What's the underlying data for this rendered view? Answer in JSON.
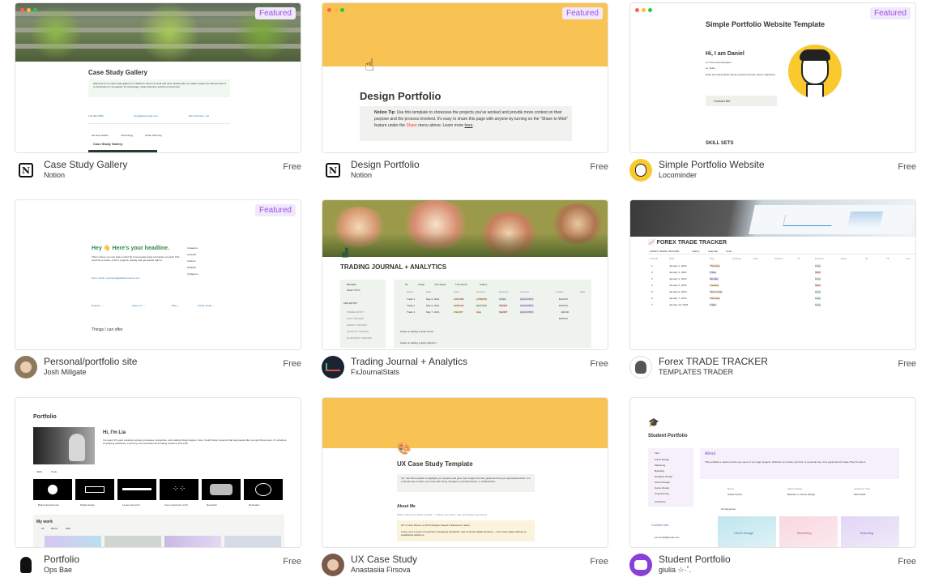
{
  "featured_label": "Featured",
  "templates": [
    {
      "name": "Case Study Gallery",
      "creator": "Notion",
      "price": "Free",
      "featured": true,
      "avatar_icon": "notion-logo-icon",
      "preview": {
        "title": "Case Study Gallery",
        "callout": "Welcome to my case study gallery! I'm thrilled to share my work and case studies with you. Each project you will see here is a culmination of my passion for technology, urban planning, and the environment.",
        "contacts": [
          "123-456-7890",
          "hey@placeomain.com",
          "San Francisco, CA"
        ],
        "tabs": [
          "All case studies",
          "Technology",
          "Urban Planning"
        ],
        "section": "Case Study Gallery"
      }
    },
    {
      "name": "Design Portfolio",
      "creator": "Notion",
      "price": "Free",
      "featured": true,
      "avatar_icon": "notion-logo-icon",
      "preview": {
        "title": "Design Portfolio",
        "tip_label": "Notion Tip:",
        "tip": "Use this template to showcase the projects you've worked and provide more context on their purpose and the process involved. It's easy to share this page with anyone by turning on the \"Share to Web\" feature under the",
        "share": "Share",
        "tip_end": "menu above. Learn more",
        "link": "here"
      }
    },
    {
      "name": "Simple Portfolio Website",
      "creator": "Locominder",
      "price": "Free",
      "featured": true,
      "avatar_icon": "cartoon-avatar-icon",
      "preview": {
        "title": "Simple Portfolio Website Template",
        "greeting": "Hi, I am Daniel",
        "role": "I'm Front-end developer",
        "years": "3+ Years",
        "desc": "Enter short description about yourself and your career objectives",
        "button": "Contact Me",
        "skills": "SKILL SETS"
      }
    },
    {
      "name": "Personal/portfolio site",
      "creator": "Josh Millgate",
      "price": "Free",
      "featured": true,
      "avatar_icon": "person-avatar-icon",
      "preview": {
        "headline": "Hey 👋 Here's your headline.",
        "body": "This is where you can write a short bit to let people know a bit about yourself. This could be a career, a list of projects, quickly and get started right in.",
        "email": "Get in touch: yourname@platformname.com",
        "links": [
          "Instagram",
          "LinkedIn",
          "Linktree",
          "Dribbble",
          "Instagram"
        ],
        "nav": [
          "Projects →",
          "About me →",
          "Blog →",
          "Social media →"
        ],
        "offer": "Things I can offer"
      }
    },
    {
      "name": "Trading Journal + Analytics",
      "creator": "FxJournalStats",
      "price": "Free",
      "featured": false,
      "avatar_icon": "chart-logo-icon",
      "preview": {
        "title": "TRADING JOURNAL + ANALYTICS",
        "sidebar": [
          "REVIEW",
          "ANALYTICS",
          "ADD ENTRY",
          "TRADE ENTRY",
          "DAILY REVIEW",
          "WEEKLY REVIEW",
          "MONTHLY REVIEW",
          "QUARTERLY REVIEW"
        ],
        "tabs": [
          "All",
          "Today",
          "This Week",
          "This Month",
          "Gallery"
        ],
        "columns": [
          "Name",
          "Date",
          "Pairs",
          "Session",
          "Direction",
          "Account",
          "Profit/L...",
          "Rule"
        ],
        "rows": [
          {
            "name": "Trade 1",
            "date": "May 6, 2021",
            "pair": "AUDUSD",
            "session": "LONDON",
            "dir": "LONG",
            "account": "ACCOUNT1",
            "pl": "$120.00"
          },
          {
            "name": "Trade 2",
            "date": "May 6, 2021",
            "pair": "NZDUSD",
            "session": "New York",
            "dir": "SHORT",
            "account": "ACCOUNT1",
            "pl": "$120.00"
          },
          {
            "name": "Trade 3",
            "date": "May 7, 2021",
            "pair": "USDJPY",
            "session": "Asia",
            "dir": "SHORT",
            "account": "ACCOUNT1",
            "pl": "-$20.00"
          }
        ],
        "sum": "$220.00",
        "guides": [
          "Guide on adding a trade check",
          "Guide on adding a daily reflection"
        ]
      }
    },
    {
      "name": "Forex TRADE TRACKER",
      "creator": "TEMPLATES TRADER",
      "price": "Free",
      "featured": false,
      "avatar_icon": "person-avatar-icon",
      "preview": {
        "title": "📈 FOREX TRADE TRACKER",
        "tabs": [
          "FOREX TRADE TRACKER",
          "Gallery",
          "Calendar",
          "Chart"
        ],
        "columns": [
          "# Trade",
          "Date",
          "Day",
          "Strategy",
          "Pair",
          "Session",
          "TF",
          "Position",
          "Entry",
          "SL",
          "TP",
          "Lots"
        ],
        "rows": [
          {
            "n": "1",
            "date": "January 2, 2023",
            "day": "Thursday",
            "pos": "Long"
          },
          {
            "n": "2",
            "date": "January 3, 2023",
            "day": "Friday",
            "pos": "Short"
          },
          {
            "n": "3",
            "date": "January 4, 2023",
            "day": "Monday",
            "pos": "Long"
          },
          {
            "n": "4",
            "date": "January 5, 2023",
            "day": "Tuesday",
            "pos": "Short"
          },
          {
            "n": "5",
            "date": "January 6, 2023",
            "day": "Wednesday",
            "pos": "Long"
          },
          {
            "n": "6",
            "date": "January 7, 2023",
            "day": "Thursday",
            "pos": "Long"
          },
          {
            "n": "7",
            "date": "January 10, 2023",
            "day": "Friday",
            "pos": "Long"
          }
        ]
      }
    },
    {
      "name": "Portfolio",
      "creator": "Ops Bae",
      "price": "Free",
      "featured": false,
      "avatar_icon": "cartoon-avatar-icon",
      "preview": {
        "title": "Portfolio",
        "greeting": "Hi, I'm Lia",
        "bio": "I've spent 15 years creating complex processes, productive, and relating things happen. Now, I build Notion systems that help people like you get things done. I'm all about simplifying workflows, improving communication and finding solutions that work.",
        "tabs": [
          "Skills",
          "Tools"
        ],
        "skills": [
          "Brand development",
          "Digital design",
          "Layout and print",
          "User experience (UX)",
          "Research",
          "Illustration"
        ],
        "work": "My work",
        "work_tabs": [
          "All",
          "Brand",
          "Web"
        ]
      }
    },
    {
      "name": "UX Case Study",
      "creator": "Anastasiia Firsova",
      "price": "Free",
      "featured": false,
      "avatar_icon": "person-avatar-icon",
      "preview": {
        "title": "UX Case Study Template",
        "tip": "Tip: Use this template to highlight your projects and give more insight into their goals and how you approached them. It's a simple way to share your work with hiring managers, potential clients, or collaborators.",
        "about": "About Me",
        "about_sub": "Write a short intro about yourself — include your name, role, and design experience.",
        "intro": "Hi! I'm Alex Rivera, a UX/UI designer based in Barcelona, Spain.",
        "intro2": "I have over 4 years of experience designing thoughtful, user-centered digital products — from early-stage startups to established platforms."
      }
    },
    {
      "name": "Student Portfolio",
      "creator": "giulia ☆·˚.",
      "price": "Free",
      "featured": false,
      "avatar_icon": "student-avatar-icon",
      "preview": {
        "title": "Student Portfolio",
        "nav": [
          "Intro",
          "UX/UI Design",
          "Marketing",
          "Branding",
          "Narrative Design",
          "Sound Design",
          "Game Design",
          "Programming",
          "Art/Assets"
        ],
        "about": "About",
        "about_text": "This portfolio is made to show you some of my major projects. Whether for a class, job hunt, or personal use, it's a great start for Save Time To Give it.",
        "fields": [
          "Name",
          "Field of Study",
          "Academic Year"
        ],
        "values": [
          "Giada Garcia",
          "Bachelor in Game Design",
          "2024-2025"
        ],
        "contact": "Contact info",
        "email": "your.email@email.com",
        "categories": "All categories",
        "tiles": [
          "UX/UI Design",
          "Marketing",
          "Branding"
        ]
      }
    }
  ]
}
